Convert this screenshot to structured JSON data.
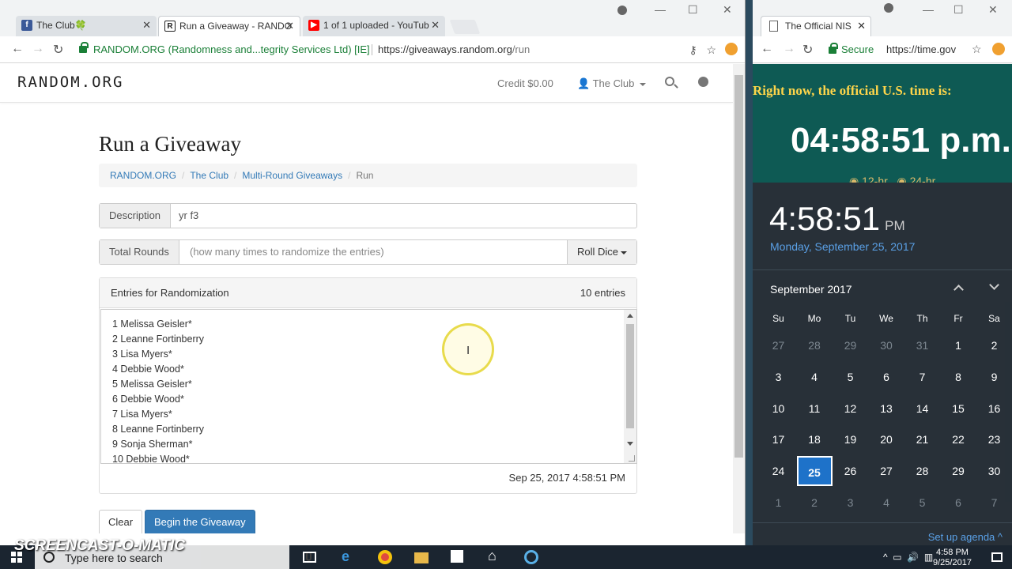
{
  "left_browser": {
    "tabs": [
      {
        "title": "The Club🍀",
        "favicon": "facebook-icon",
        "color": "#3b5998"
      },
      {
        "title": "Run a Giveaway - RANDO",
        "favicon": "random-org-icon",
        "color": "#222222"
      },
      {
        "title": "1 of 1 uploaded - YouTub",
        "favicon": "youtube-icon",
        "color": "#ff0000"
      }
    ],
    "omnibox": {
      "secure_label": "RANDOM.ORG (Randomness and...tegrity Services Ltd) [IE]",
      "url_host": "https://giveaways.random.org",
      "url_path": "/run"
    }
  },
  "site": {
    "logo": "RANDOM.ORG",
    "credit": "Credit $0.00",
    "user": "The Club"
  },
  "page": {
    "title": "Run a Giveaway",
    "breadcrumb": [
      {
        "label": "RANDOM.ORG"
      },
      {
        "label": "The Club"
      },
      {
        "label": "Multi-Round Giveaways"
      },
      {
        "label": "Run"
      }
    ],
    "description": {
      "label": "Description",
      "value": "yr f3"
    },
    "total_rounds": {
      "label": "Total Rounds",
      "placeholder": "(how many times to randomize the entries)",
      "button": "Roll Dice"
    },
    "entries_panel": {
      "title": "Entries for Randomization",
      "count": "10 entries",
      "entries": [
        "1 Melissa Geisler*",
        "2 Leanne Fortinberry",
        "3 Lisa Myers*",
        "4 Debbie Wood*",
        "5 Melissa Geisler*",
        "6 Debbie Wood*",
        "7 Lisa Myers*",
        "8 Leanne Fortinberry",
        "9 Sonja Sherman*",
        "10 Debbie Wood*"
      ],
      "timestamp": "Sep 25, 2017 4:58:51 PM"
    },
    "buttons": {
      "clear": "Clear",
      "begin": "Begin the Giveaway"
    }
  },
  "right_browser": {
    "tab_title": "The Official NIS",
    "secure_label": "Secure",
    "url": "https://time.gov",
    "banner": "Right now, the official U.S. time is:",
    "big_time": "04:58:51 p.m.",
    "radio_12": "12-hr",
    "radio_24": "24-hr"
  },
  "clock_flyout": {
    "time": "4:58:51",
    "ampm": "PM",
    "date": "Monday, September 25, 2017",
    "month": "September 2017",
    "weekdays": [
      "Su",
      "Mo",
      "Tu",
      "We",
      "Th",
      "Fr",
      "Sa"
    ],
    "weeks": [
      [
        {
          "d": "27",
          "dim": true
        },
        {
          "d": "28",
          "dim": true
        },
        {
          "d": "29",
          "dim": true
        },
        {
          "d": "30",
          "dim": true
        },
        {
          "d": "31",
          "dim": true
        },
        {
          "d": "1"
        },
        {
          "d": "2"
        }
      ],
      [
        {
          "d": "3"
        },
        {
          "d": "4"
        },
        {
          "d": "5"
        },
        {
          "d": "6"
        },
        {
          "d": "7"
        },
        {
          "d": "8"
        },
        {
          "d": "9"
        }
      ],
      [
        {
          "d": "10"
        },
        {
          "d": "11"
        },
        {
          "d": "12"
        },
        {
          "d": "13"
        },
        {
          "d": "14"
        },
        {
          "d": "15"
        },
        {
          "d": "16"
        }
      ],
      [
        {
          "d": "17"
        },
        {
          "d": "18"
        },
        {
          "d": "19"
        },
        {
          "d": "20"
        },
        {
          "d": "21"
        },
        {
          "d": "22"
        },
        {
          "d": "23"
        }
      ],
      [
        {
          "d": "24"
        },
        {
          "d": "25",
          "today": true
        },
        {
          "d": "26"
        },
        {
          "d": "27"
        },
        {
          "d": "28"
        },
        {
          "d": "29"
        },
        {
          "d": "30"
        }
      ],
      [
        {
          "d": "1",
          "dim": true
        },
        {
          "d": "2",
          "dim": true
        },
        {
          "d": "3",
          "dim": true
        },
        {
          "d": "4",
          "dim": true
        },
        {
          "d": "5",
          "dim": true
        },
        {
          "d": "6",
          "dim": true
        },
        {
          "d": "7",
          "dim": true
        }
      ]
    ],
    "agenda": "Set up agenda"
  },
  "taskbar": {
    "search_placeholder": "Type here to search",
    "time": "4:58 PM",
    "date": "9/25/2017"
  },
  "watermark": {
    "recorded": "Recorded with",
    "brand": "SCREENCAST-O-MATIC"
  }
}
